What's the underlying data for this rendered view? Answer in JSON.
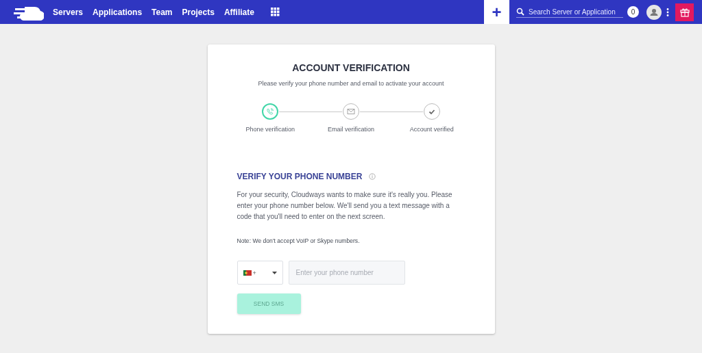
{
  "nav": {
    "items": [
      "Servers",
      "Applications",
      "Team",
      "Projects",
      "Affiliate"
    ],
    "add_label": "+",
    "search": {
      "placeholder": "Search Server or Application"
    },
    "notifications": "0"
  },
  "card": {
    "title": "ACCOUNT VERIFICATION",
    "subtitle": "Please verify your phone number and email to activate your account",
    "steps": [
      {
        "kind": "phone",
        "label": "Phone verification",
        "active": true
      },
      {
        "kind": "email",
        "label": "Email verification",
        "active": false
      },
      {
        "kind": "check",
        "label": "Account verified",
        "active": false
      }
    ],
    "section_title": "VERIFY YOUR PHONE NUMBER",
    "description": "For your security, Cloudways wants to make sure it's really you. Please enter your phone number below. We'll send you a text message with a code that you'll need to enter on the next screen.",
    "note": "Note: We don't accept VoIP or Skype numbers.",
    "country_code": "+",
    "phone": {
      "placeholder": "Enter your phone number"
    },
    "send_button": {
      "label": "SEND SMS",
      "disabled": true
    }
  }
}
